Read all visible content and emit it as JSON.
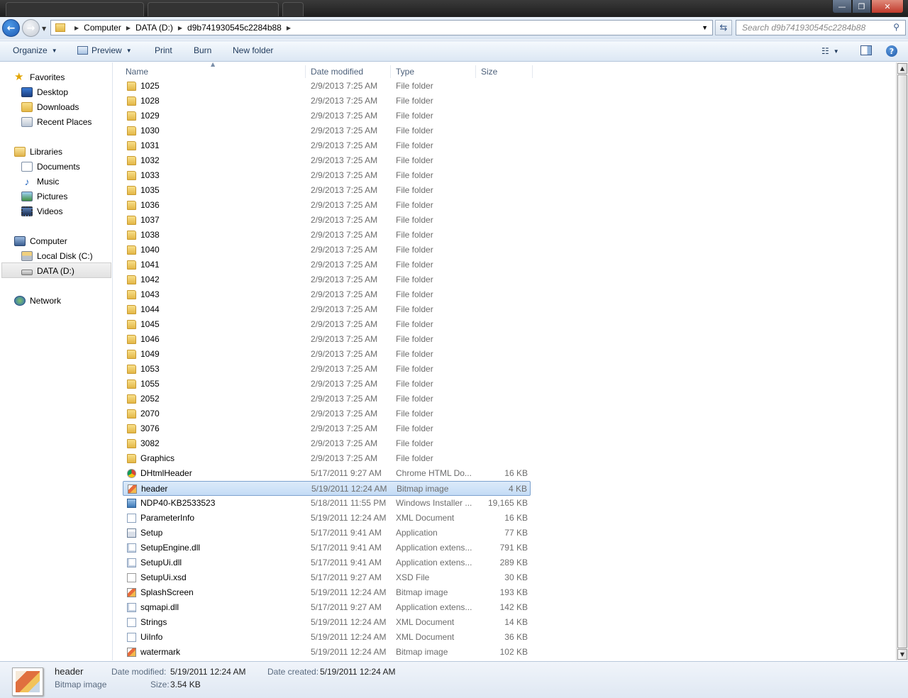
{
  "window": {
    "minimize_glyph": "—",
    "maximize_glyph": "❐",
    "close_glyph": "✕"
  },
  "address": {
    "breadcrumbs": [
      "Computer",
      "DATA (D:)",
      "d9b741930545c2284b88"
    ],
    "search_placeholder": "Search d9b741930545c2284b88"
  },
  "toolbar": {
    "organize": "Organize",
    "preview": "Preview",
    "print": "Print",
    "burn": "Burn",
    "new_folder": "New folder"
  },
  "nav": {
    "favorites": "Favorites",
    "desktop": "Desktop",
    "downloads": "Downloads",
    "recent_places": "Recent Places",
    "libraries": "Libraries",
    "documents": "Documents",
    "music": "Music",
    "pictures": "Pictures",
    "videos": "Videos",
    "computer": "Computer",
    "local_disk": "Local Disk (C:)",
    "data_drive": "DATA (D:)",
    "network": "Network"
  },
  "columns": {
    "name": "Name",
    "date": "Date modified",
    "type": "Type",
    "size": "Size"
  },
  "files": [
    {
      "name": "1025",
      "date": "2/9/2013 7:25 AM",
      "type": "File folder",
      "size": "",
      "icon": "folder-icon"
    },
    {
      "name": "1028",
      "date": "2/9/2013 7:25 AM",
      "type": "File folder",
      "size": "",
      "icon": "folder-icon"
    },
    {
      "name": "1029",
      "date": "2/9/2013 7:25 AM",
      "type": "File folder",
      "size": "",
      "icon": "folder-icon"
    },
    {
      "name": "1030",
      "date": "2/9/2013 7:25 AM",
      "type": "File folder",
      "size": "",
      "icon": "folder-icon"
    },
    {
      "name": "1031",
      "date": "2/9/2013 7:25 AM",
      "type": "File folder",
      "size": "",
      "icon": "folder-icon"
    },
    {
      "name": "1032",
      "date": "2/9/2013 7:25 AM",
      "type": "File folder",
      "size": "",
      "icon": "folder-icon"
    },
    {
      "name": "1033",
      "date": "2/9/2013 7:25 AM",
      "type": "File folder",
      "size": "",
      "icon": "folder-icon"
    },
    {
      "name": "1035",
      "date": "2/9/2013 7:25 AM",
      "type": "File folder",
      "size": "",
      "icon": "folder-icon"
    },
    {
      "name": "1036",
      "date": "2/9/2013 7:25 AM",
      "type": "File folder",
      "size": "",
      "icon": "folder-icon"
    },
    {
      "name": "1037",
      "date": "2/9/2013 7:25 AM",
      "type": "File folder",
      "size": "",
      "icon": "folder-icon"
    },
    {
      "name": "1038",
      "date": "2/9/2013 7:25 AM",
      "type": "File folder",
      "size": "",
      "icon": "folder-icon"
    },
    {
      "name": "1040",
      "date": "2/9/2013 7:25 AM",
      "type": "File folder",
      "size": "",
      "icon": "folder-icon"
    },
    {
      "name": "1041",
      "date": "2/9/2013 7:25 AM",
      "type": "File folder",
      "size": "",
      "icon": "folder-icon"
    },
    {
      "name": "1042",
      "date": "2/9/2013 7:25 AM",
      "type": "File folder",
      "size": "",
      "icon": "folder-icon"
    },
    {
      "name": "1043",
      "date": "2/9/2013 7:25 AM",
      "type": "File folder",
      "size": "",
      "icon": "folder-icon"
    },
    {
      "name": "1044",
      "date": "2/9/2013 7:25 AM",
      "type": "File folder",
      "size": "",
      "icon": "folder-icon"
    },
    {
      "name": "1045",
      "date": "2/9/2013 7:25 AM",
      "type": "File folder",
      "size": "",
      "icon": "folder-icon"
    },
    {
      "name": "1046",
      "date": "2/9/2013 7:25 AM",
      "type": "File folder",
      "size": "",
      "icon": "folder-icon"
    },
    {
      "name": "1049",
      "date": "2/9/2013 7:25 AM",
      "type": "File folder",
      "size": "",
      "icon": "folder-icon"
    },
    {
      "name": "1053",
      "date": "2/9/2013 7:25 AM",
      "type": "File folder",
      "size": "",
      "icon": "folder-icon"
    },
    {
      "name": "1055",
      "date": "2/9/2013 7:25 AM",
      "type": "File folder",
      "size": "",
      "icon": "folder-icon"
    },
    {
      "name": "2052",
      "date": "2/9/2013 7:25 AM",
      "type": "File folder",
      "size": "",
      "icon": "folder-icon"
    },
    {
      "name": "2070",
      "date": "2/9/2013 7:25 AM",
      "type": "File folder",
      "size": "",
      "icon": "folder-icon"
    },
    {
      "name": "3076",
      "date": "2/9/2013 7:25 AM",
      "type": "File folder",
      "size": "",
      "icon": "folder-icon"
    },
    {
      "name": "3082",
      "date": "2/9/2013 7:25 AM",
      "type": "File folder",
      "size": "",
      "icon": "folder-icon"
    },
    {
      "name": "Graphics",
      "date": "2/9/2013 7:25 AM",
      "type": "File folder",
      "size": "",
      "icon": "folder-icon"
    },
    {
      "name": "DHtmlHeader",
      "date": "5/17/2011 9:27 AM",
      "type": "Chrome HTML Do...",
      "size": "16 KB",
      "icon": "chrome-icon"
    },
    {
      "name": "header",
      "date": "5/19/2011 12:24 AM",
      "type": "Bitmap image",
      "size": "4 KB",
      "icon": "bitmap-icon",
      "selected": true
    },
    {
      "name": "NDP40-KB2533523",
      "date": "5/18/2011 11:55 PM",
      "type": "Windows Installer ...",
      "size": "19,165 KB",
      "icon": "installer-icon"
    },
    {
      "name": "ParameterInfo",
      "date": "5/19/2011 12:24 AM",
      "type": "XML Document",
      "size": "16 KB",
      "icon": "xml-icon"
    },
    {
      "name": "Setup",
      "date": "5/17/2011 9:41 AM",
      "type": "Application",
      "size": "77 KB",
      "icon": "app-icon"
    },
    {
      "name": "SetupEngine.dll",
      "date": "5/17/2011 9:41 AM",
      "type": "Application extens...",
      "size": "791 KB",
      "icon": "dll-icon"
    },
    {
      "name": "SetupUi.dll",
      "date": "5/17/2011 9:41 AM",
      "type": "Application extens...",
      "size": "289 KB",
      "icon": "dll-icon"
    },
    {
      "name": "SetupUi.xsd",
      "date": "5/17/2011 9:27 AM",
      "type": "XSD File",
      "size": "30 KB",
      "icon": "file-icon"
    },
    {
      "name": "SplashScreen",
      "date": "5/19/2011 12:24 AM",
      "type": "Bitmap image",
      "size": "193 KB",
      "icon": "bitmap-icon"
    },
    {
      "name": "sqmapi.dll",
      "date": "5/17/2011 9:27 AM",
      "type": "Application extens...",
      "size": "142 KB",
      "icon": "dll-icon"
    },
    {
      "name": "Strings",
      "date": "5/19/2011 12:24 AM",
      "type": "XML Document",
      "size": "14 KB",
      "icon": "xml-icon"
    },
    {
      "name": "UiInfo",
      "date": "5/19/2011 12:24 AM",
      "type": "XML Document",
      "size": "36 KB",
      "icon": "xml-icon"
    },
    {
      "name": "watermark",
      "date": "5/19/2011 12:24 AM",
      "type": "Bitmap image",
      "size": "102 KB",
      "icon": "bitmap-icon"
    }
  ],
  "details": {
    "name": "header",
    "type": "Bitmap image",
    "date_modified_label": "Date modified:",
    "date_modified": "5/19/2011 12:24 AM",
    "date_created_label": "Date created:",
    "date_created": "5/19/2011 12:24 AM",
    "size_label": "Size:",
    "size": "3.54 KB"
  }
}
